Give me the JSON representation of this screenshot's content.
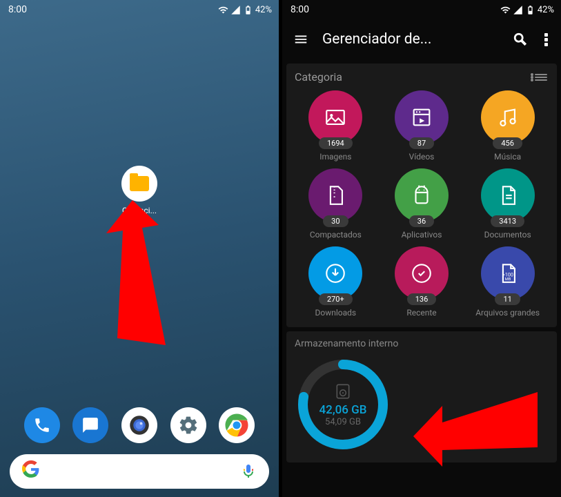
{
  "statusbar": {
    "time": "8:00",
    "battery": "42%"
  },
  "left": {
    "app_label": "Gerenci...",
    "dock": [
      "phone",
      "message",
      "camera",
      "settings",
      "chrome"
    ]
  },
  "right": {
    "appbar": {
      "title": "Gerenciador de..."
    },
    "category": {
      "header": "Categoria",
      "items": [
        {
          "label": "Imagens",
          "count": "1694",
          "color": "c-pink",
          "icon": "image"
        },
        {
          "label": "Vídeos",
          "count": "87",
          "color": "c-purple",
          "icon": "video"
        },
        {
          "label": "Música",
          "count": "456",
          "color": "c-orange",
          "icon": "music"
        },
        {
          "label": "Compactados",
          "count": "30",
          "color": "c-dpurple",
          "icon": "zip"
        },
        {
          "label": "Aplicativos",
          "count": "36",
          "color": "c-green",
          "icon": "android"
        },
        {
          "label": "Documentos",
          "count": "3413",
          "color": "c-teal",
          "icon": "doc"
        },
        {
          "label": "Downloads",
          "count": "270+",
          "color": "c-blue",
          "icon": "download"
        },
        {
          "label": "Recente",
          "count": "136",
          "color": "c-magenta",
          "icon": "recent"
        },
        {
          "label": "Arquivos grandes",
          "count": "11",
          "color": "c-indigo",
          "icon": "large"
        }
      ]
    },
    "storage": {
      "header": "Armazenamento interno",
      "used": "42,06 GB",
      "total": "54,09 GB",
      "percent": 78
    }
  }
}
